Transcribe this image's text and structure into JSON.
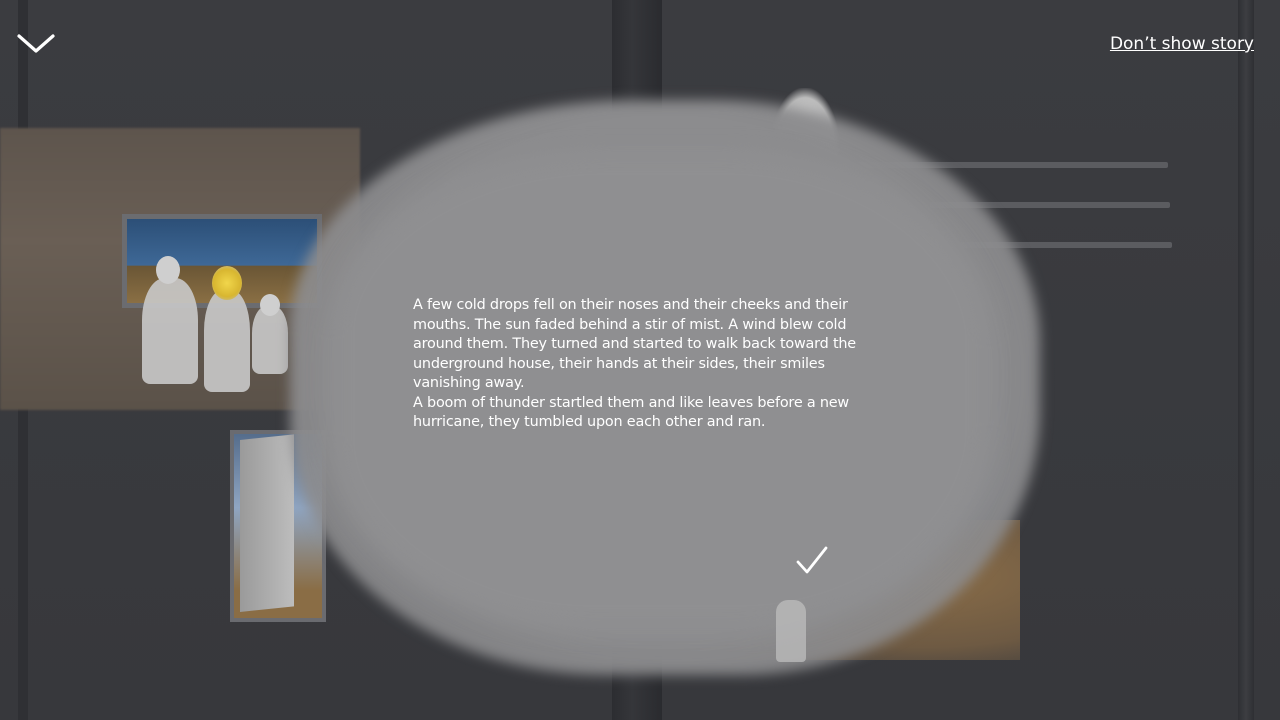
{
  "controls": {
    "collapse_icon": "chevron-down-icon",
    "dont_show_label": "Don’t show story",
    "confirm_icon": "checkmark-icon"
  },
  "story": {
    "paragraphs": [
      "A few cold drops fell on their noses and their cheeks and their mouths. The sun faded behind a stir of mist. A wind blew cold around them. They turned and started to walk back toward the underground house, their hands at their sides, their smiles vanishing away.",
      "A boom of thunder startled them and like leaves before a new hurricane, they tumbled upon each other and ran."
    ]
  },
  "colors": {
    "background": "#3a3b3f",
    "mist": "#8f8f91",
    "text": "#ffffff",
    "accent_hair": "#f1d64b",
    "earth_brown": "#8a6d48"
  }
}
